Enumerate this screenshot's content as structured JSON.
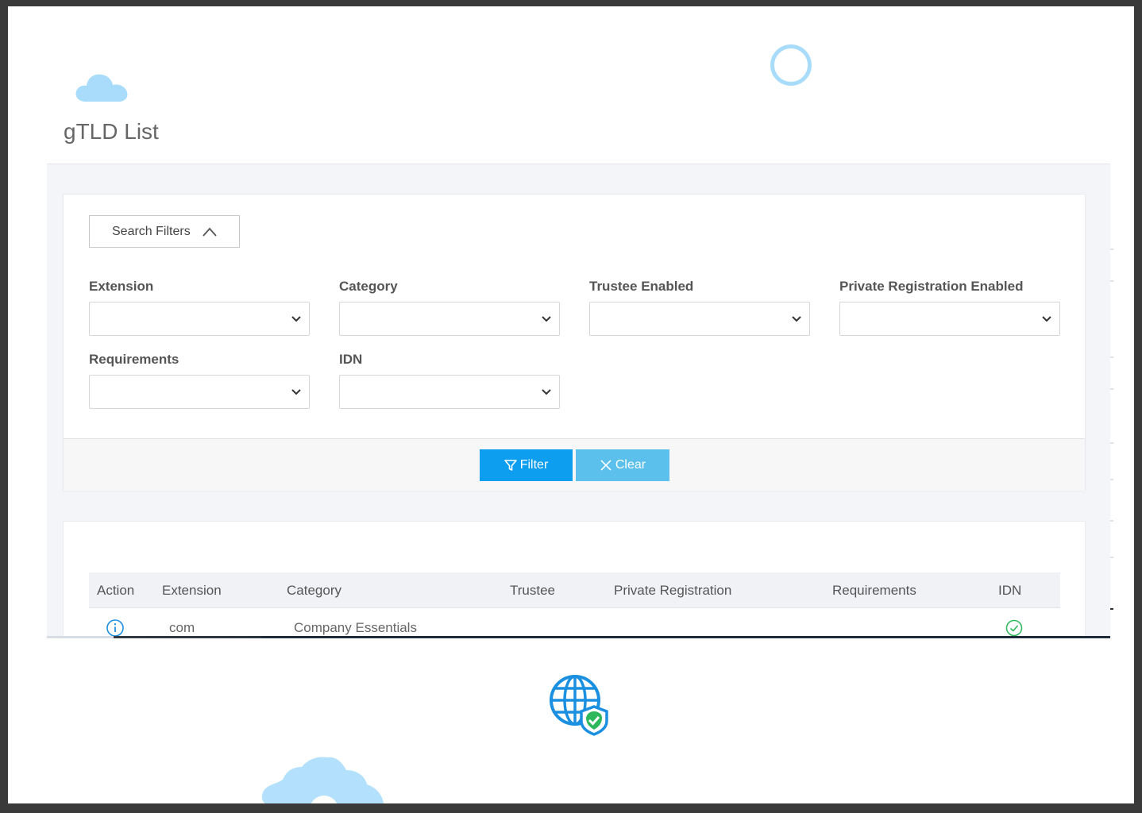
{
  "page": {
    "title": "gTLD List"
  },
  "filters": {
    "toggle_label": "Search Filters",
    "fields": {
      "extension": {
        "label": "Extension",
        "value": ""
      },
      "category": {
        "label": "Category",
        "value": ""
      },
      "trustee_enabled": {
        "label": "Trustee Enabled",
        "value": ""
      },
      "private_registration_enabled": {
        "label": "Private Registration Enabled",
        "value": ""
      },
      "requirements": {
        "label": "Requirements",
        "value": ""
      },
      "idn": {
        "label": "IDN",
        "value": ""
      }
    },
    "filter_button": "Filter",
    "clear_button": "Clear"
  },
  "table": {
    "columns": {
      "action": "Action",
      "extension": "Extension",
      "category": "Category",
      "trustee": "Trustee",
      "private_registration": "Private Registration",
      "requirements": "Requirements",
      "idn": "IDN"
    },
    "rows": [
      {
        "extension": "com",
        "category": "Company Essentials",
        "trustee": "",
        "private_registration": "",
        "requirements": "",
        "idn": "check-circle-icon"
      }
    ]
  },
  "colors": {
    "primary": "#0d9ef0",
    "secondary": "#5bc0eb",
    "success": "#2eb85c",
    "decor": "#a9dcfb"
  },
  "icons": {
    "cloud": "cloud-icon",
    "ring": "ring-icon",
    "gear": "gear-icon",
    "globe": "globe-shield-icon",
    "info": "info-icon",
    "check": "check-circle-icon"
  }
}
